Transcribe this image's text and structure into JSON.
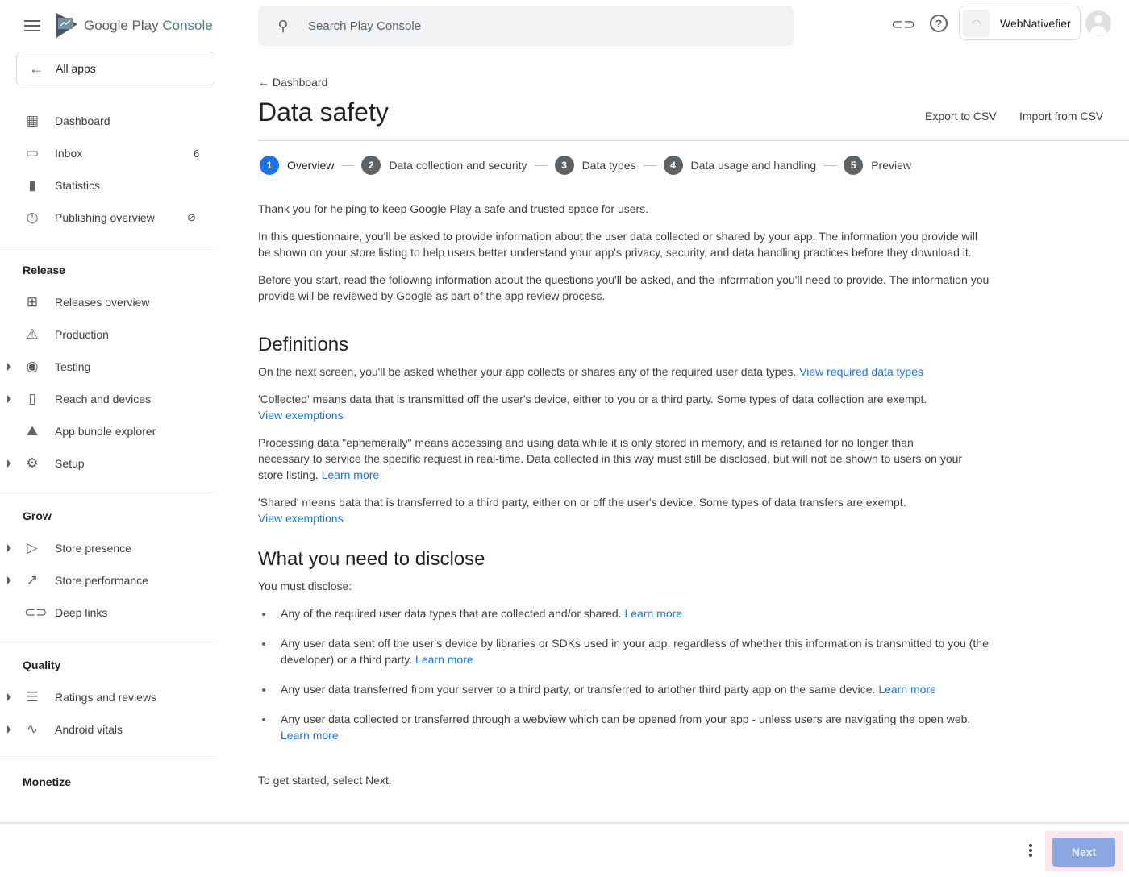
{
  "app": {
    "logo_text": "Google Play",
    "logo_suffix": "Console"
  },
  "sidebar": {
    "all_apps": "All apps",
    "top_items": [
      {
        "label": "Dashboard",
        "icon": "dashboard-icon"
      },
      {
        "label": "Inbox",
        "icon": "inbox-icon",
        "count": "6"
      },
      {
        "label": "Statistics",
        "icon": "bar-chart-icon"
      },
      {
        "label": "Publishing overview",
        "icon": "schedule-icon"
      }
    ],
    "sections": [
      {
        "title": "Release",
        "items": [
          "Releases overview",
          "Production",
          "Testing",
          "Reach and devices",
          "App bundle explorer",
          "Setup"
        ]
      },
      {
        "title": "Grow",
        "items": [
          "Store presence",
          "Store performance",
          "Deep links"
        ]
      },
      {
        "title": "Quality",
        "items": [
          "Ratings and reviews",
          "Android vitals"
        ]
      },
      {
        "title": "Monetize",
        "items": []
      }
    ]
  },
  "header": {
    "search_placeholder": "Search Play Console",
    "app_name": "WebNativefier"
  },
  "page": {
    "breadcrumb": "Dashboard",
    "title": "Data safety",
    "export": "Export to CSV",
    "import": "Import from CSV"
  },
  "steps": [
    {
      "n": "1",
      "label": "Overview",
      "active": true
    },
    {
      "n": "2",
      "label": "Data collection and security"
    },
    {
      "n": "3",
      "label": "Data types"
    },
    {
      "n": "4",
      "label": "Data usage and handling"
    },
    {
      "n": "5",
      "label": "Preview"
    }
  ],
  "content": {
    "p1": "Thank you for helping to keep Google Play a safe and trusted space for users.",
    "p2": "In this questionnaire, you'll be asked to provide information about the user data collected or shared by your app. The information you provide will be shown on your store listing to help users better understand your app's privacy, security, and data handling practices before they download it.",
    "p3": "Before you start, read the following information about the questions you'll be asked, and the information you'll need to provide. The information you provide will be reviewed by Google as part of the app review process.",
    "h_definitions": "Definitions",
    "d1": "On the next screen, you'll be asked whether your app collects or shares any of the required user data types.",
    "d1_link": "View required data types",
    "d2": "'Collected' means data that is transmitted off the user's device, either to you or a third party. Some types of data collection are exempt.",
    "d2_link": "View exemptions",
    "d3": "Processing data \"ephemerally\" means accessing and using data while it is only stored in memory, and is retained for no longer than necessary to service the specific request in real-time. Data collected in this way must still be disclosed, but will not be shown to users on your store listing.",
    "d3_link": "Learn more",
    "d4": "'Shared' means data that is transferred to a third party, either on or off the user's device. Some types of data transfers are exempt.",
    "d4_link": "View exemptions",
    "h_disclose": "What you need to disclose",
    "must": "You must disclose:",
    "bullets": [
      {
        "text": "Any of the required user data types that are collected and/or shared.",
        "link": "Learn more"
      },
      {
        "text": "Any user data sent off the user's device by libraries or SDKs used in your app, regardless of whether this information is transmitted to you (the developer) or a third party.",
        "link": "Learn more"
      },
      {
        "text": "Any user data transferred from your server to a third party, or transferred to another third party app on the same device.",
        "link": "Learn more"
      },
      {
        "text": "Any user data collected or transferred through a webview which can be opened from your app - unless users are navigating the open web.",
        "link": "Learn more"
      }
    ],
    "start": "To get started, select Next."
  },
  "footer": {
    "next": "Next"
  },
  "colors": {
    "accent": "#1a73e8",
    "next_disabled": "#8aa6e3"
  }
}
